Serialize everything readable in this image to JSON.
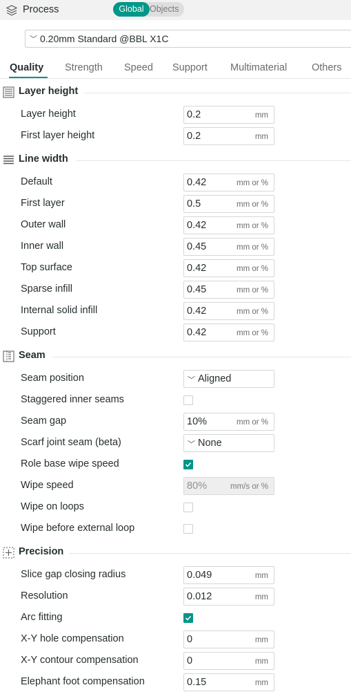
{
  "header": {
    "title": "Process",
    "toggle_global": "Global",
    "toggle_objects": "Objects",
    "active_toggle": "Global"
  },
  "preset": {
    "value": "0.20mm Standard @BBL X1C"
  },
  "tabs": [
    {
      "label": "Quality",
      "active": true
    },
    {
      "label": "Strength",
      "active": false
    },
    {
      "label": "Speed",
      "active": false
    },
    {
      "label": "Support",
      "active": false
    },
    {
      "label": "Multimaterial",
      "active": false
    },
    {
      "label": "Others",
      "active": false
    }
  ],
  "colors": {
    "accent": "#009688",
    "header_bg": "#f2f2f2",
    "text": "#262e30"
  },
  "sections": {
    "layer_height": {
      "title": "Layer height",
      "icon": "layer-height-icon",
      "rows": [
        {
          "label": "Layer height",
          "value": "0.2",
          "unit": "mm"
        },
        {
          "label": "First layer height",
          "value": "0.2",
          "unit": "mm"
        }
      ]
    },
    "line_width": {
      "title": "Line width",
      "icon": "line-width-icon",
      "rows": [
        {
          "label": "Default",
          "value": "0.42",
          "unit": "mm or %"
        },
        {
          "label": "First layer",
          "value": "0.5",
          "unit": "mm or %"
        },
        {
          "label": "Outer wall",
          "value": "0.42",
          "unit": "mm or %"
        },
        {
          "label": "Inner wall",
          "value": "0.45",
          "unit": "mm or %"
        },
        {
          "label": "Top surface",
          "value": "0.42",
          "unit": "mm or %"
        },
        {
          "label": "Sparse infill",
          "value": "0.45",
          "unit": "mm or %"
        },
        {
          "label": "Internal solid infill",
          "value": "0.42",
          "unit": "mm or %"
        },
        {
          "label": "Support",
          "value": "0.42",
          "unit": "mm or %"
        }
      ]
    },
    "seam": {
      "title": "Seam",
      "icon": "seam-icon",
      "seam_position": {
        "label": "Seam position",
        "value": "Aligned"
      },
      "staggered": {
        "label": "Staggered inner seams",
        "checked": false
      },
      "seam_gap": {
        "label": "Seam gap",
        "value": "10%",
        "unit": "mm or %"
      },
      "scarf": {
        "label": "Scarf joint seam (beta)",
        "value": "None"
      },
      "role_wipe": {
        "label": "Role base wipe speed",
        "checked": true
      },
      "wipe_speed": {
        "label": "Wipe speed",
        "value": "80%",
        "unit": "mm/s or %",
        "disabled": true
      },
      "wipe_loops": {
        "label": "Wipe on loops",
        "checked": false
      },
      "wipe_before": {
        "label": "Wipe before external loop",
        "checked": false
      }
    },
    "precision": {
      "title": "Precision",
      "icon": "precision-icon",
      "slice_gap": {
        "label": "Slice gap closing radius",
        "value": "0.049",
        "unit": "mm"
      },
      "resolution": {
        "label": "Resolution",
        "value": "0.012",
        "unit": "mm"
      },
      "arc": {
        "label": "Arc fitting",
        "checked": true
      },
      "xy_hole": {
        "label": "X-Y hole compensation",
        "value": "0",
        "unit": "mm"
      },
      "xy_contour": {
        "label": "X-Y contour compensation",
        "value": "0",
        "unit": "mm"
      },
      "elephant": {
        "label": "Elephant foot compensation",
        "value": "0.15",
        "unit": "mm"
      }
    }
  }
}
